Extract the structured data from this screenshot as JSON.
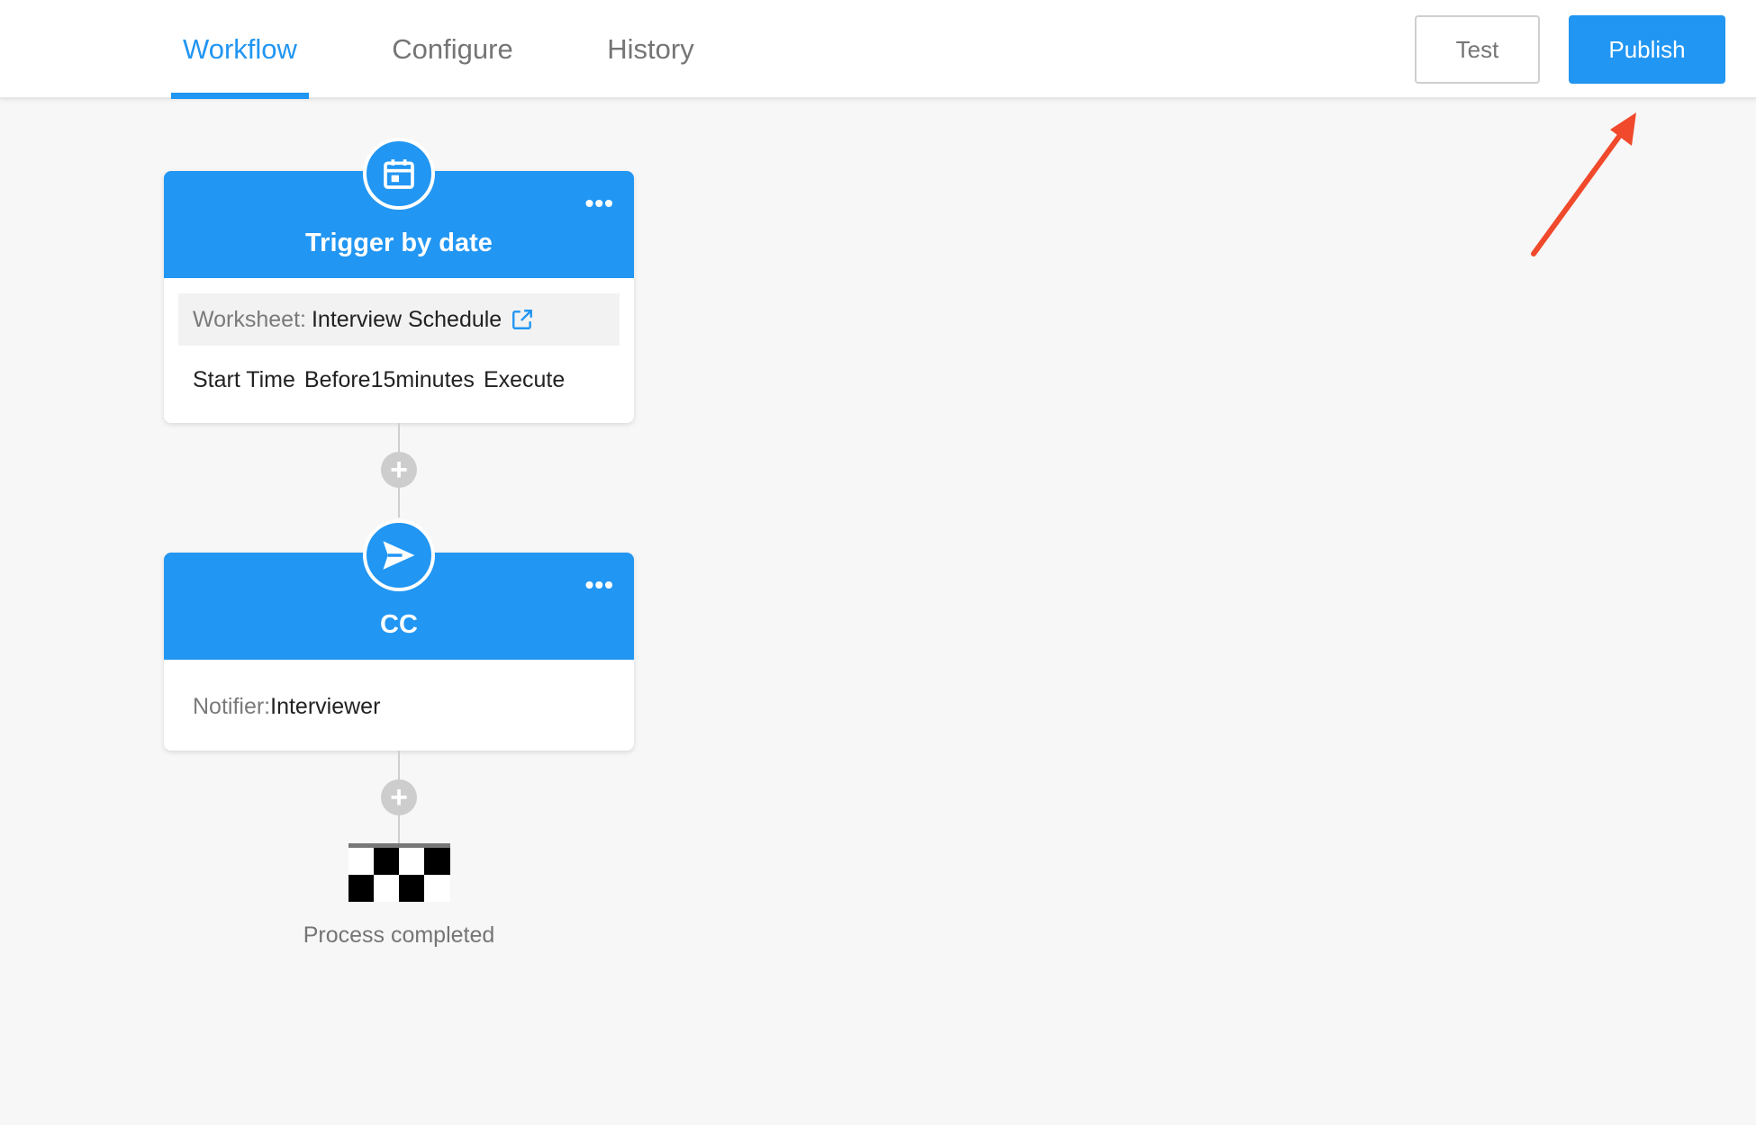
{
  "tabs": [
    {
      "label": "Workflow",
      "active": true
    },
    {
      "label": "Configure",
      "active": false
    },
    {
      "label": "History",
      "active": false
    }
  ],
  "buttons": {
    "test": "Test",
    "publish": "Publish"
  },
  "nodes": {
    "trigger": {
      "title": "Trigger by date",
      "icon": "calendar-icon",
      "worksheet_label": "Worksheet:",
      "worksheet_value": "Interview Schedule",
      "condition": [
        "Start Time",
        "Before15minutes",
        "Execute"
      ]
    },
    "cc": {
      "title": "CC",
      "icon": "send-icon",
      "notifier_label": "Notifier:",
      "notifier_value": "Interviewer"
    }
  },
  "end": {
    "label": "Process completed",
    "icon": "checkered-flag-icon"
  },
  "annotation": {
    "type": "red-arrow",
    "target": "publish-button",
    "color": "#f0492c"
  },
  "colors": {
    "accent": "#2196f3",
    "muted": "#757575",
    "plus": "#cdcdcd"
  }
}
